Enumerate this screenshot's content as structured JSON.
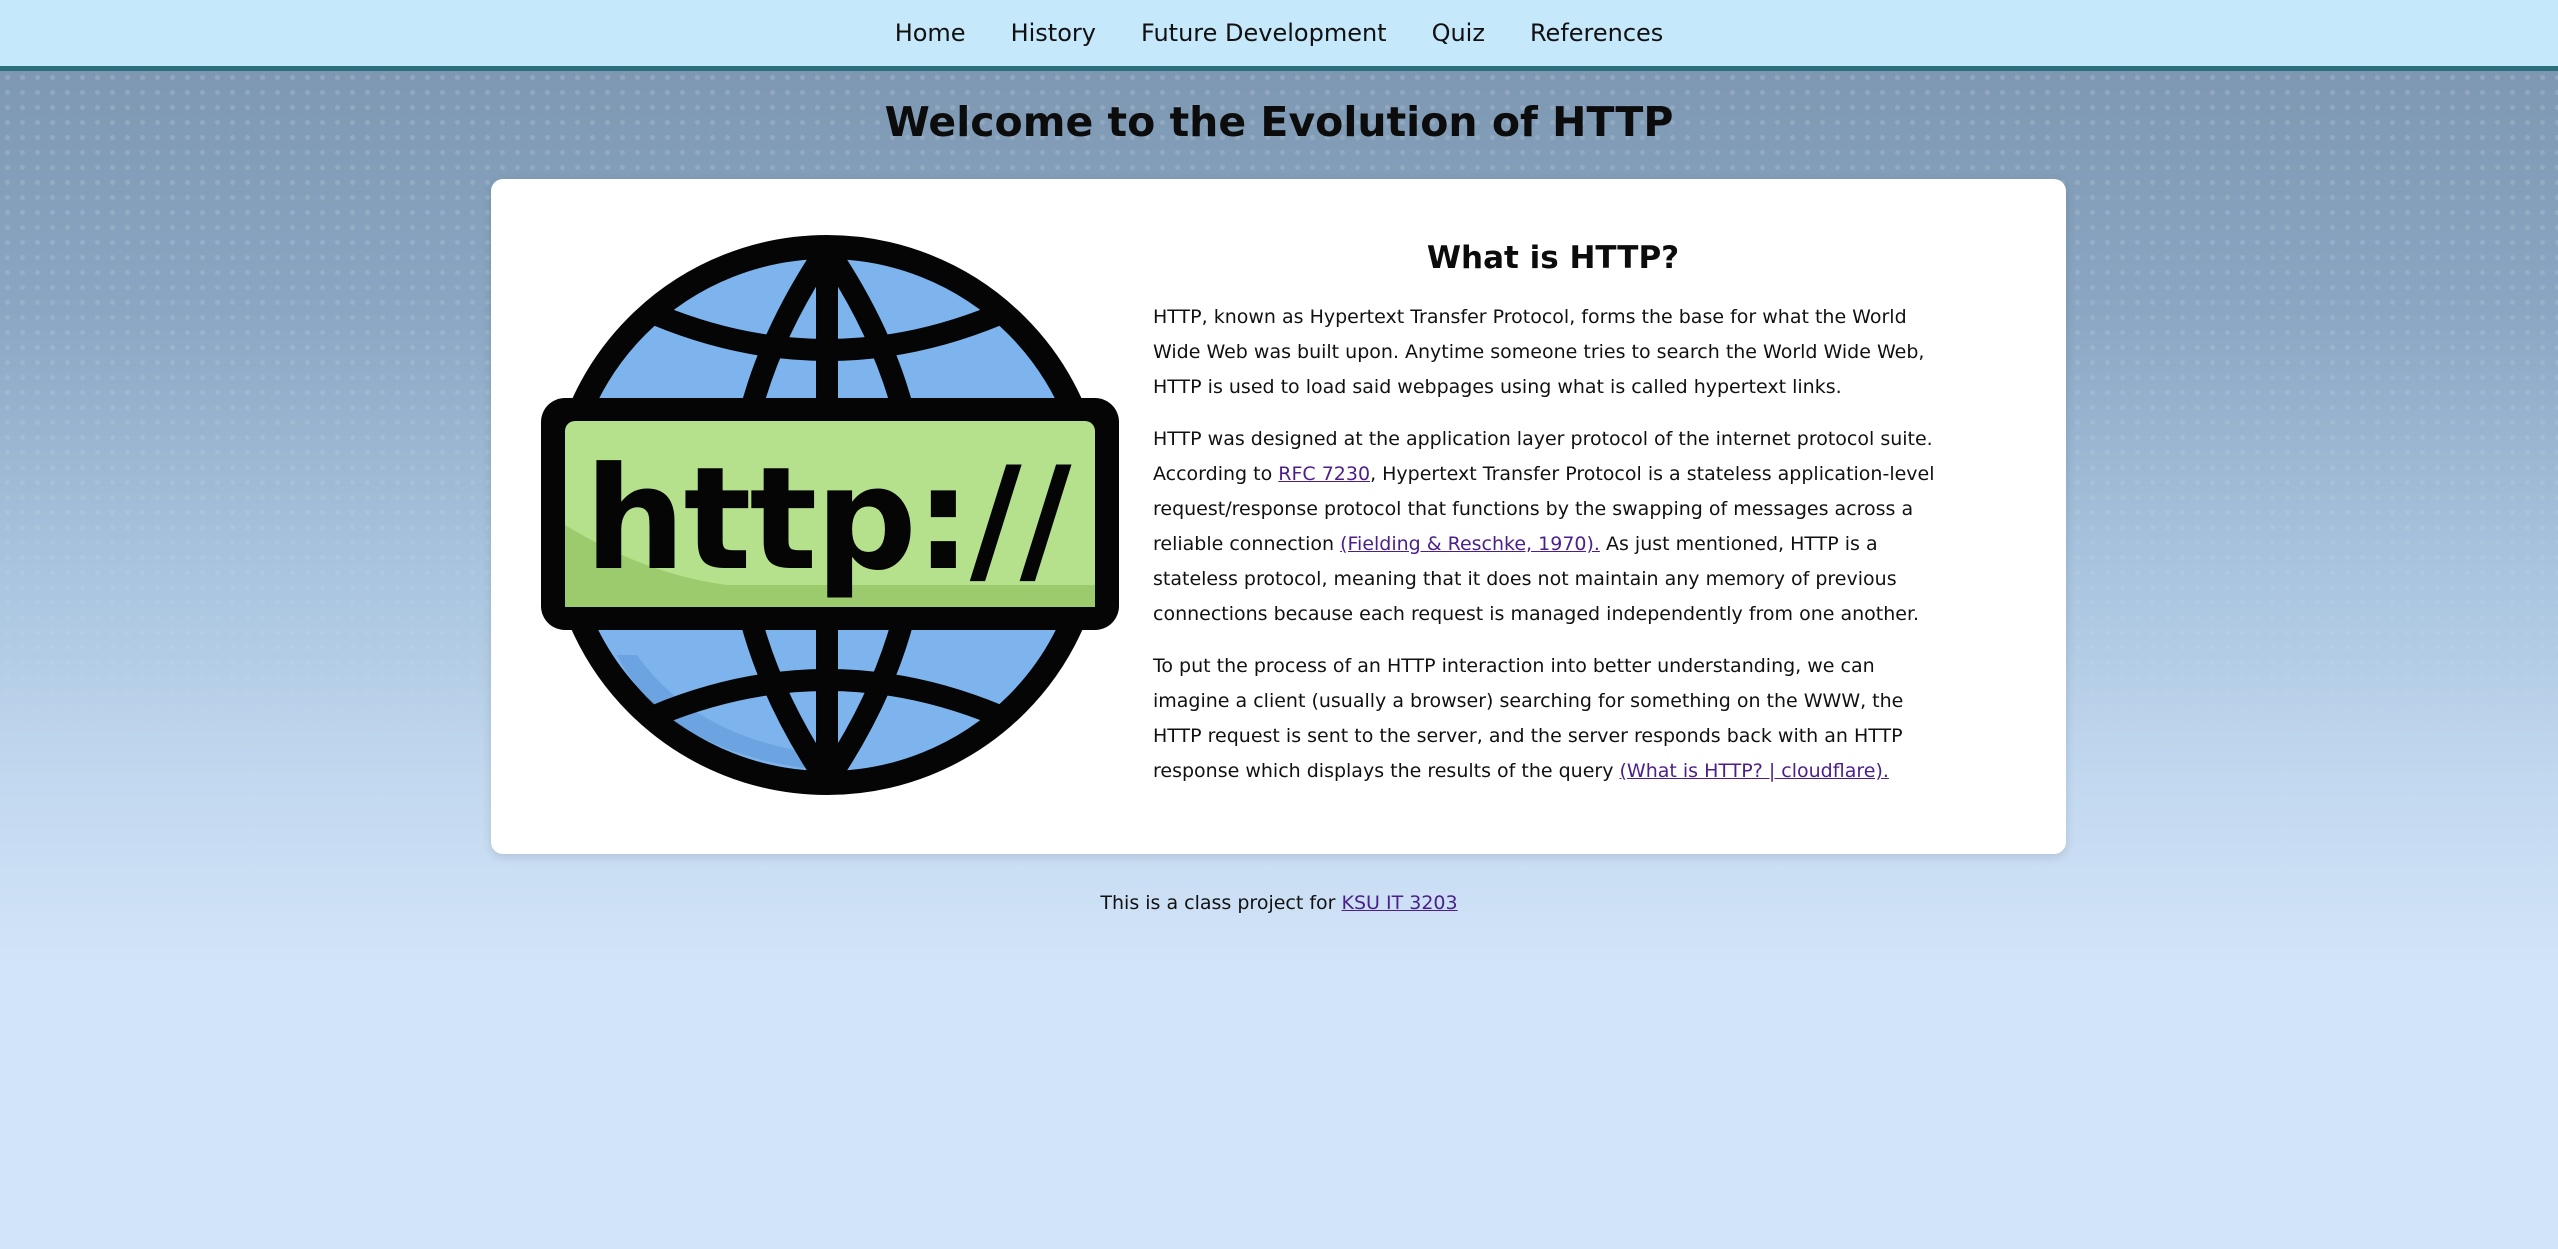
{
  "nav": {
    "items": [
      {
        "label": "Home"
      },
      {
        "label": "History"
      },
      {
        "label": "Future Development"
      },
      {
        "label": "Quiz"
      },
      {
        "label": "References"
      }
    ]
  },
  "page": {
    "title": "Welcome to the Evolution of HTTP"
  },
  "logo": {
    "text": "http://",
    "colors": {
      "globe": "#7db4ee",
      "band": "#b5e08c",
      "outline": "#050505"
    }
  },
  "main": {
    "heading": "What is HTTP?",
    "para1": "HTTP, known as Hypertext Transfer Protocol, forms the base for what the World Wide Web was built upon. Anytime someone tries to search the World Wide Web, HTTP is used to load said webpages using what is called hypertext links.",
    "para2_part1": "HTTP was designed at the application layer protocol of the internet protocol suite. According to ",
    "rfc_link": "RFC 7230",
    "para2_part2": ", Hypertext Transfer Protocol is a stateless application-level request/response protocol that functions by the swapping of messages across a reliable connection ",
    "citation1": "(Fielding & Reschke, 1970).",
    "para2_part3": " As just mentioned, HTTP is a stateless protocol, meaning that it does not maintain any memory of previous connections because each request is managed independently from one another.",
    "para3_part1": "To put the process of an HTTP interaction into better understanding, we can imagine a client (usually a browser) searching for something on the WWW, the HTTP request is sent to the server, and the server responds back with an HTTP response which displays the results of the query ",
    "citation2": "(What is HTTP? | cloudflare)."
  },
  "footer": {
    "text": "This is a class project for ",
    "link": "KSU IT 3203"
  },
  "colors": {
    "nav_bg": "#c6e8fb",
    "nav_border": "#2b6f7c",
    "link": "#4b1f8a",
    "page_bg": "#d2e4f8"
  }
}
